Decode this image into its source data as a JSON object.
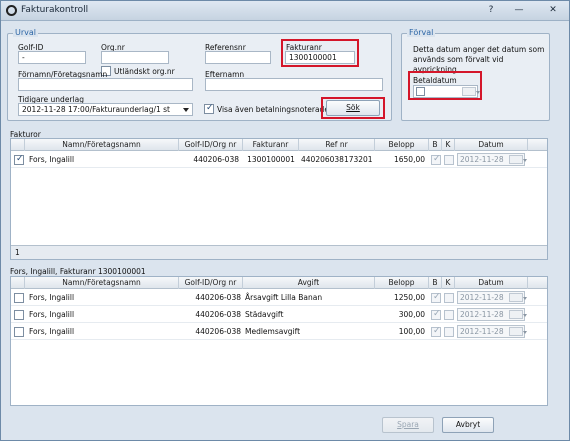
{
  "window": {
    "title": "Fakturakontroll",
    "help": "?",
    "minimize": "—",
    "close": "✕"
  },
  "urval": {
    "legend": "Urval",
    "golf_id_label": "Golf-ID",
    "golf_id_value": "-",
    "orgnr_label": "Org.nr",
    "orgnr_value": "",
    "foreign_orgnr_label": "Utländskt org.nr",
    "referensnr_label": "Referensnr",
    "referensnr_value": "",
    "fakturanr_label": "Fakturanr",
    "fakturanr_value": "1300100001",
    "fornamn_label": "Förnamn/Företagsnamn",
    "fornamn_value": "",
    "efternamn_label": "Efternamn",
    "efternamn_value": "",
    "tidigare_label": "Tidigare underlag",
    "tidigare_value": "2012-11-28 17:00/Fakturaunderlag/1 st",
    "visa_label": "Visa även betalningsnoterade",
    "sok_label": "Sök"
  },
  "forval": {
    "legend": "Förval",
    "description": "Detta datum anger det datum som används som förvalt vid avprickning.",
    "betaldatum_label": "Betaldatum",
    "betaldatum_value": ""
  },
  "fakturor": {
    "label": "Fakturor",
    "headers": [
      "Namn/Företagsnamn",
      "Golf-ID/Org nr",
      "Fakturanr",
      "Ref nr",
      "Belopp",
      "B",
      "K",
      "Datum"
    ],
    "rows": [
      {
        "name": "Fors, Ingalill",
        "golf_id": "440206-038",
        "fakturanr": "1300100001",
        "refnr": "440206038173201 31",
        "belopp": "1650,00",
        "datum": "2012-11-28"
      }
    ],
    "count": "1"
  },
  "detail": {
    "label": "Fors, Ingalill, Fakturanr 1300100001",
    "headers": [
      "Namn/Företagsnamn",
      "Golf-ID/Org nr",
      "Avgift",
      "Belopp",
      "B",
      "K",
      "Datum"
    ],
    "rows": [
      {
        "name": "Fors, Ingalill",
        "golf_id": "440206-038",
        "avgift": "Årsavgift Lilla Banan",
        "belopp": "1250,00",
        "datum": "2012-11-28"
      },
      {
        "name": "Fors, Ingalill",
        "golf_id": "440206-038",
        "avgift": "Städavgift",
        "belopp": "300,00",
        "datum": "2012-11-28"
      },
      {
        "name": "Fors, Ingalill",
        "golf_id": "440206-038",
        "avgift": "Medlemsavgift",
        "belopp": "100,00",
        "datum": "2012-11-28"
      }
    ]
  },
  "buttons": {
    "spara": "Spara",
    "avbryt": "Avbryt"
  },
  "colors": {
    "highlight": "#d4162a",
    "legend": "#2d66a6"
  }
}
